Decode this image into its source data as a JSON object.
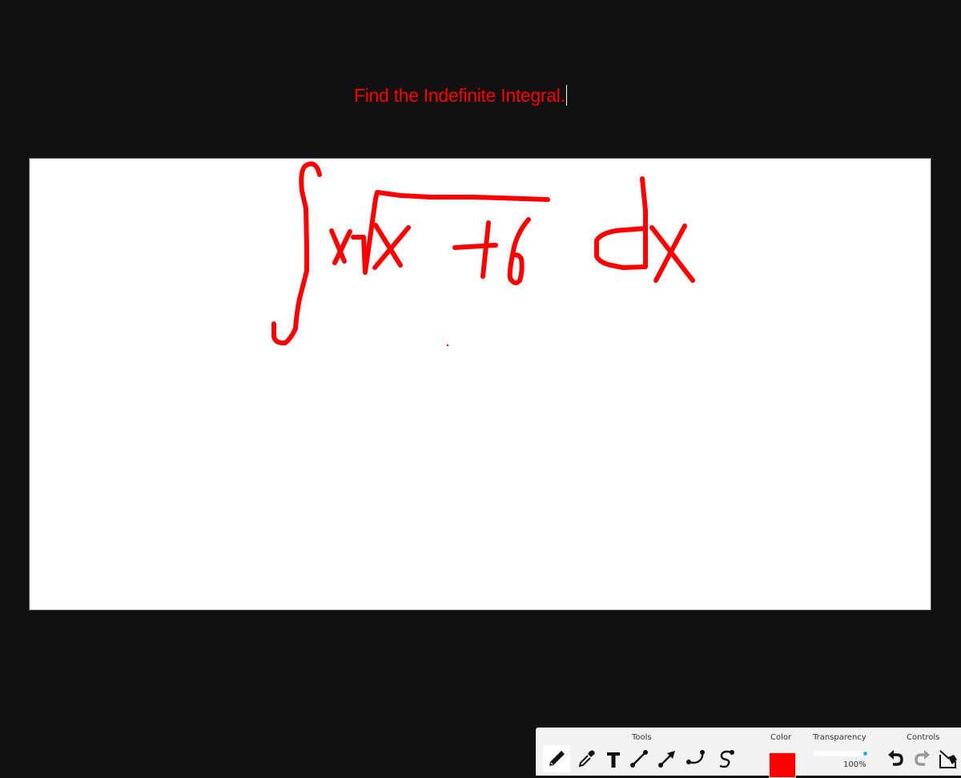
{
  "prompt": {
    "text": "Find the Indefinite Integral.",
    "color": "#ff0000"
  },
  "canvas": {
    "background": "#ffffff",
    "ink_color": "#ff0000",
    "handwritten_expression": "∫ x√(x+6) dx"
  },
  "toolbar": {
    "tools_label": "Tools",
    "tools": [
      {
        "name": "pencil",
        "icon": "pencil-icon",
        "active": true
      },
      {
        "name": "eyedropper",
        "icon": "eyedropper-icon",
        "active": false
      },
      {
        "name": "text",
        "icon": "text-icon",
        "active": false
      },
      {
        "name": "line",
        "icon": "line-icon",
        "active": false
      },
      {
        "name": "arrow",
        "icon": "arrow-icon",
        "active": false
      },
      {
        "name": "curve",
        "icon": "curve-icon",
        "active": false
      },
      {
        "name": "bezier",
        "icon": "bezier-icon",
        "active": false
      }
    ],
    "color_label": "Color",
    "selected_color": "#ff0000",
    "transparency_label": "Transparency",
    "transparency_value": "100%",
    "transparency_fraction": 1.0,
    "controls_label": "Controls",
    "controls": [
      {
        "name": "undo",
        "icon": "undo-icon",
        "enabled": true
      },
      {
        "name": "redo",
        "icon": "redo-icon",
        "enabled": false
      },
      {
        "name": "clear",
        "icon": "clear-canvas-icon",
        "enabled": true
      }
    ]
  }
}
